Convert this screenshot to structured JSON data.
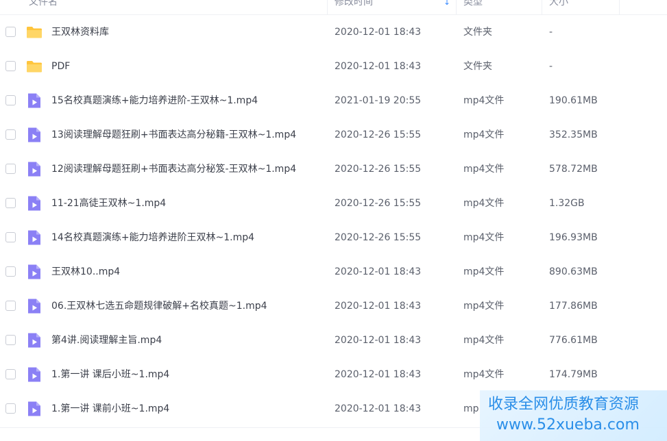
{
  "columns": {
    "name": "文件名",
    "modified": "修改时间",
    "type": "类型",
    "size": "大小"
  },
  "colors": {
    "folder": "#ffc53d",
    "video": "#8b80f5",
    "accent": "#3b8cff",
    "watermark": "#2a8ee8"
  },
  "files": [
    {
      "name": "王双林资料库",
      "modified": "2020-12-01 18:43",
      "type": "文件夹",
      "size": "-",
      "icon": "folder-icon"
    },
    {
      "name": "PDF",
      "modified": "2020-12-01 18:43",
      "type": "文件夹",
      "size": "-",
      "icon": "folder-icon"
    },
    {
      "name": "15名校真题演练+能力培养进阶-王双林~1.mp4",
      "modified": "2021-01-19 20:55",
      "type": "mp4文件",
      "size": "190.61MB",
      "icon": "video-file-icon"
    },
    {
      "name": "13阅读理解母题狂刷+书面表达高分秘籍-王双林~1.mp4",
      "modified": "2020-12-26 15:55",
      "type": "mp4文件",
      "size": "352.35MB",
      "icon": "video-file-icon"
    },
    {
      "name": "12阅读理解母题狂刷+书面表达高分秘笈-王双林~1.mp4",
      "modified": "2020-12-26 15:55",
      "type": "mp4文件",
      "size": "578.72MB",
      "icon": "video-file-icon"
    },
    {
      "name": "11-21高徒王双林~1.mp4",
      "modified": "2020-12-26 15:55",
      "type": "mp4文件",
      "size": "1.32GB",
      "icon": "video-file-icon"
    },
    {
      "name": "14名校真题演练+能力培养进阶王双林~1.mp4",
      "modified": "2020-12-26 15:55",
      "type": "mp4文件",
      "size": "196.93MB",
      "icon": "video-file-icon"
    },
    {
      "name": "王双林10..mp4",
      "modified": "2020-12-01 18:43",
      "type": "mp4文件",
      "size": "890.63MB",
      "icon": "video-file-icon"
    },
    {
      "name": "06.王双林七选五命题规律破解+名校真题~1.mp4",
      "modified": "2020-12-01 18:43",
      "type": "mp4文件",
      "size": "177.86MB",
      "icon": "video-file-icon"
    },
    {
      "name": "第4讲.阅读理解主旨.mp4",
      "modified": "2020-12-01 18:43",
      "type": "mp4文件",
      "size": "776.61MB",
      "icon": "video-file-icon"
    },
    {
      "name": "1.第一讲 课后小班~1.mp4",
      "modified": "2020-12-01 18:43",
      "type": "mp4文件",
      "size": "174.79MB",
      "icon": "video-file-icon"
    },
    {
      "name": "1.第一讲 课前小班~1.mp4",
      "modified": "2020-12-01 18:43",
      "type": "mp",
      "size": "",
      "icon": "video-file-icon"
    }
  ],
  "watermark": {
    "line1": "收录全网优质教育资源",
    "line2": "www.52xueba.com"
  }
}
